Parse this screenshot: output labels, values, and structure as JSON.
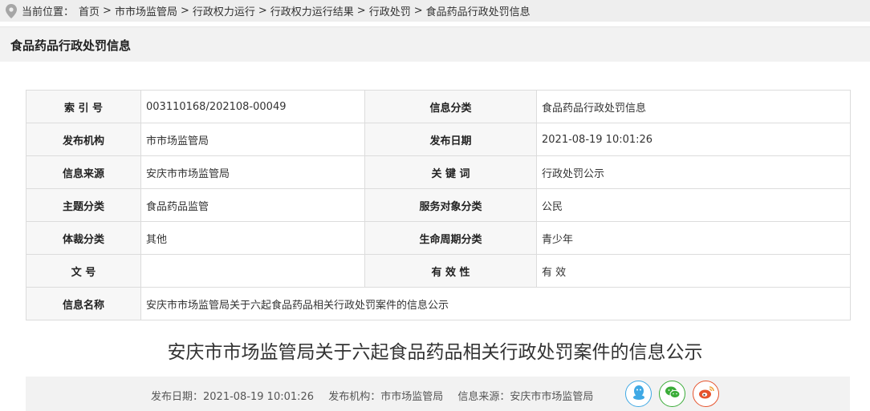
{
  "breadcrumb": {
    "label": "当前位置：",
    "items": [
      "首页",
      "市市场监管局",
      "行政权力运行",
      "行政权力运行结果",
      "行政处罚",
      "食品药品行政处罚信息"
    ],
    "separator": ">"
  },
  "section": {
    "title": "食品药品行政处罚信息"
  },
  "meta": {
    "index_label": "索 引 号",
    "index_value": "003110168/202108-00049",
    "category_label": "信息分类",
    "category_value": "食品药品行政处罚信息",
    "publisher_label": "发布机构",
    "publisher_value": "市市场监管局",
    "date_label": "发布日期",
    "date_value": "2021-08-19 10:01:26",
    "source_label": "信息来源",
    "source_value": "安庆市市场监管局",
    "keyword_label": "关 键 词",
    "keyword_value": "行政处罚公示",
    "topic_label": "主题分类",
    "topic_value": "食品药品监管",
    "audience_label": "服务对象分类",
    "audience_value": "公民",
    "genre_label": "体裁分类",
    "genre_value": "其他",
    "lifecycle_label": "生命周期分类",
    "lifecycle_value": "青少年",
    "docno_label": "文 号",
    "docno_value": "",
    "validity_label": "有 效 性",
    "validity_value": "有 效",
    "name_label": "信息名称",
    "name_value": "安庆市市场监管局关于六起食品药品相关行政处罚案件的信息公示"
  },
  "article": {
    "title": "安庆市市场监管局关于六起食品药品相关行政处罚案件的信息公示"
  },
  "footer": {
    "date": "发布日期：2021-08-19 10:01:26",
    "publisher": "发布机构：市市场监管局",
    "source": "信息来源：安庆市市场监管局",
    "share_icons": [
      "qq-icon",
      "wechat-icon",
      "weibo-icon"
    ]
  },
  "colors": {
    "qq": "#3fa9e5",
    "wechat": "#3aac38",
    "weibo": "#e6532d",
    "pin": "#a6a6a6"
  }
}
